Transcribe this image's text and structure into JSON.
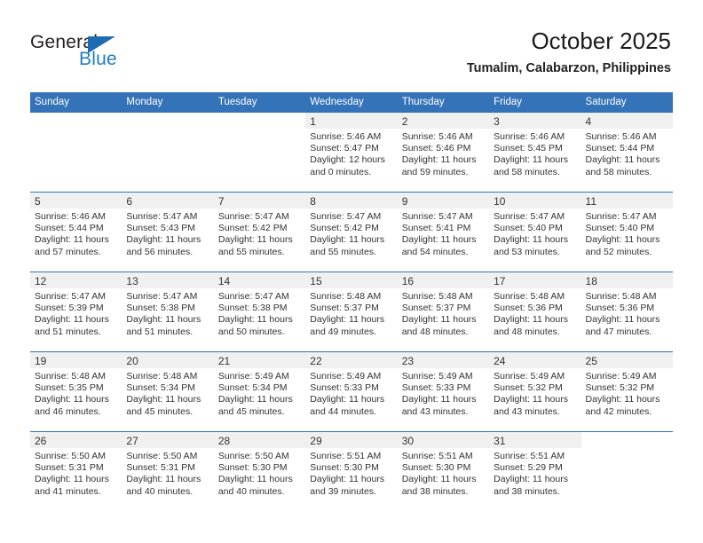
{
  "logo": {
    "word1": "General",
    "word2": "Blue",
    "triangle_color": "#1b6cb5",
    "blue_text_color": "#1f7dc4"
  },
  "header": {
    "title": "October 2025",
    "subtitle": "Tumalim, Calabarzon, Philippines"
  },
  "theme": {
    "header_blue": "#3573b9",
    "daynum_bar": "#f0f0f0",
    "text": "#333333"
  },
  "weekday_headers": [
    "Sunday",
    "Monday",
    "Tuesday",
    "Wednesday",
    "Thursday",
    "Friday",
    "Saturday"
  ],
  "weeks": [
    [
      {
        "day": "",
        "lines": []
      },
      {
        "day": "",
        "lines": []
      },
      {
        "day": "",
        "lines": []
      },
      {
        "day": "1",
        "lines": [
          "Sunrise: 5:46 AM",
          "Sunset: 5:47 PM",
          "Daylight: 12 hours",
          "and 0 minutes."
        ]
      },
      {
        "day": "2",
        "lines": [
          "Sunrise: 5:46 AM",
          "Sunset: 5:46 PM",
          "Daylight: 11 hours",
          "and 59 minutes."
        ]
      },
      {
        "day": "3",
        "lines": [
          "Sunrise: 5:46 AM",
          "Sunset: 5:45 PM",
          "Daylight: 11 hours",
          "and 58 minutes."
        ]
      },
      {
        "day": "4",
        "lines": [
          "Sunrise: 5:46 AM",
          "Sunset: 5:44 PM",
          "Daylight: 11 hours",
          "and 58 minutes."
        ]
      }
    ],
    [
      {
        "day": "5",
        "lines": [
          "Sunrise: 5:46 AM",
          "Sunset: 5:44 PM",
          "Daylight: 11 hours",
          "and 57 minutes."
        ]
      },
      {
        "day": "6",
        "lines": [
          "Sunrise: 5:47 AM",
          "Sunset: 5:43 PM",
          "Daylight: 11 hours",
          "and 56 minutes."
        ]
      },
      {
        "day": "7",
        "lines": [
          "Sunrise: 5:47 AM",
          "Sunset: 5:42 PM",
          "Daylight: 11 hours",
          "and 55 minutes."
        ]
      },
      {
        "day": "8",
        "lines": [
          "Sunrise: 5:47 AM",
          "Sunset: 5:42 PM",
          "Daylight: 11 hours",
          "and 55 minutes."
        ]
      },
      {
        "day": "9",
        "lines": [
          "Sunrise: 5:47 AM",
          "Sunset: 5:41 PM",
          "Daylight: 11 hours",
          "and 54 minutes."
        ]
      },
      {
        "day": "10",
        "lines": [
          "Sunrise: 5:47 AM",
          "Sunset: 5:40 PM",
          "Daylight: 11 hours",
          "and 53 minutes."
        ]
      },
      {
        "day": "11",
        "lines": [
          "Sunrise: 5:47 AM",
          "Sunset: 5:40 PM",
          "Daylight: 11 hours",
          "and 52 minutes."
        ]
      }
    ],
    [
      {
        "day": "12",
        "lines": [
          "Sunrise: 5:47 AM",
          "Sunset: 5:39 PM",
          "Daylight: 11 hours",
          "and 51 minutes."
        ]
      },
      {
        "day": "13",
        "lines": [
          "Sunrise: 5:47 AM",
          "Sunset: 5:38 PM",
          "Daylight: 11 hours",
          "and 51 minutes."
        ]
      },
      {
        "day": "14",
        "lines": [
          "Sunrise: 5:47 AM",
          "Sunset: 5:38 PM",
          "Daylight: 11 hours",
          "and 50 minutes."
        ]
      },
      {
        "day": "15",
        "lines": [
          "Sunrise: 5:48 AM",
          "Sunset: 5:37 PM",
          "Daylight: 11 hours",
          "and 49 minutes."
        ]
      },
      {
        "day": "16",
        "lines": [
          "Sunrise: 5:48 AM",
          "Sunset: 5:37 PM",
          "Daylight: 11 hours",
          "and 48 minutes."
        ]
      },
      {
        "day": "17",
        "lines": [
          "Sunrise: 5:48 AM",
          "Sunset: 5:36 PM",
          "Daylight: 11 hours",
          "and 48 minutes."
        ]
      },
      {
        "day": "18",
        "lines": [
          "Sunrise: 5:48 AM",
          "Sunset: 5:36 PM",
          "Daylight: 11 hours",
          "and 47 minutes."
        ]
      }
    ],
    [
      {
        "day": "19",
        "lines": [
          "Sunrise: 5:48 AM",
          "Sunset: 5:35 PM",
          "Daylight: 11 hours",
          "and 46 minutes."
        ]
      },
      {
        "day": "20",
        "lines": [
          "Sunrise: 5:48 AM",
          "Sunset: 5:34 PM",
          "Daylight: 11 hours",
          "and 45 minutes."
        ]
      },
      {
        "day": "21",
        "lines": [
          "Sunrise: 5:49 AM",
          "Sunset: 5:34 PM",
          "Daylight: 11 hours",
          "and 45 minutes."
        ]
      },
      {
        "day": "22",
        "lines": [
          "Sunrise: 5:49 AM",
          "Sunset: 5:33 PM",
          "Daylight: 11 hours",
          "and 44 minutes."
        ]
      },
      {
        "day": "23",
        "lines": [
          "Sunrise: 5:49 AM",
          "Sunset: 5:33 PM",
          "Daylight: 11 hours",
          "and 43 minutes."
        ]
      },
      {
        "day": "24",
        "lines": [
          "Sunrise: 5:49 AM",
          "Sunset: 5:32 PM",
          "Daylight: 11 hours",
          "and 43 minutes."
        ]
      },
      {
        "day": "25",
        "lines": [
          "Sunrise: 5:49 AM",
          "Sunset: 5:32 PM",
          "Daylight: 11 hours",
          "and 42 minutes."
        ]
      }
    ],
    [
      {
        "day": "26",
        "lines": [
          "Sunrise: 5:50 AM",
          "Sunset: 5:31 PM",
          "Daylight: 11 hours",
          "and 41 minutes."
        ]
      },
      {
        "day": "27",
        "lines": [
          "Sunrise: 5:50 AM",
          "Sunset: 5:31 PM",
          "Daylight: 11 hours",
          "and 40 minutes."
        ]
      },
      {
        "day": "28",
        "lines": [
          "Sunrise: 5:50 AM",
          "Sunset: 5:30 PM",
          "Daylight: 11 hours",
          "and 40 minutes."
        ]
      },
      {
        "day": "29",
        "lines": [
          "Sunrise: 5:51 AM",
          "Sunset: 5:30 PM",
          "Daylight: 11 hours",
          "and 39 minutes."
        ]
      },
      {
        "day": "30",
        "lines": [
          "Sunrise: 5:51 AM",
          "Sunset: 5:30 PM",
          "Daylight: 11 hours",
          "and 38 minutes."
        ]
      },
      {
        "day": "31",
        "lines": [
          "Sunrise: 5:51 AM",
          "Sunset: 5:29 PM",
          "Daylight: 11 hours",
          "and 38 minutes."
        ]
      },
      {
        "day": "",
        "lines": []
      }
    ]
  ]
}
